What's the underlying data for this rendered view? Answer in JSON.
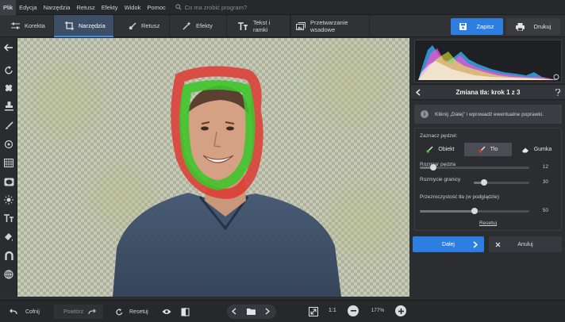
{
  "menu": [
    "Plik",
    "Edycja",
    "Narzędzia",
    "Retusz",
    "Efekty",
    "Widok",
    "Pomoc"
  ],
  "search_placeholder": "Co ma zrobić program?",
  "tabs": [
    {
      "label": "Korekta",
      "icon": "sliders-icon"
    },
    {
      "label": "Narzędzia",
      "icon": "crop-icon"
    },
    {
      "label": "Retusz",
      "icon": "brush-icon"
    },
    {
      "label": "Efekty",
      "icon": "wand-icon"
    },
    {
      "label": "Tekst i ramki",
      "icon": "text-icon"
    },
    {
      "label": "Przetwarzanie wsadowe",
      "icon": "images-icon"
    }
  ],
  "save_label": "Zapisz",
  "print_label": "Drukuj",
  "step_title": "Zmiana tła: krok 1 z 3",
  "hint_text": "Kliknij „Dalej” i wprowadź ewentualne poprawki.",
  "brush": {
    "heading": "Zaznacz pędzel:",
    "object_label": "Obiekt",
    "background_label": "Tło",
    "eraser_label": "Gumka"
  },
  "sliders": {
    "size": {
      "label": "Rozmiar pędzla",
      "value": "12",
      "fraction": 0.12
    },
    "blur": {
      "label": "Rozmycie granicy",
      "value": "30",
      "fraction": 0.18
    },
    "opacity": {
      "label": "Przezroczystość tła (w podglądzie)",
      "value": "50",
      "fraction": 0.5
    }
  },
  "reset_label": "Resetuj",
  "next_label": "Dalej",
  "cancel_label": "Anuluj",
  "bottom": {
    "undo": "Cofnij",
    "redo": "Powtórz",
    "reset": "Resetuj",
    "ratio": "1:1",
    "zoom": "177%"
  },
  "colors": {
    "accent": "#2e7de0",
    "object_mask": "#3ec52a",
    "background_mask": "#e0312a"
  }
}
